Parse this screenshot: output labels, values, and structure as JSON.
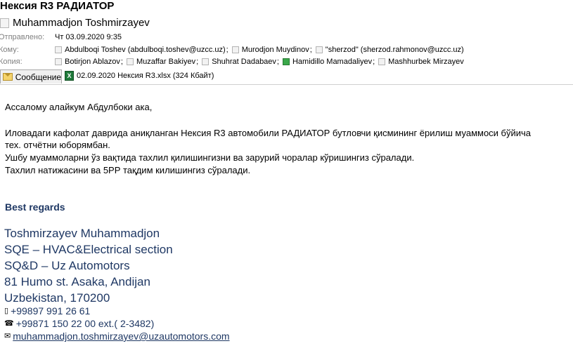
{
  "subject": "Нексия R3 РАДИАТОР",
  "sender": "Muhammadjon Toshmirzayev",
  "meta": {
    "sent_label": "Отправлено:",
    "sent_value": "Чт 03.09.2020 9:35",
    "to_label": "Кому:",
    "to": [
      "Abdulboqi Toshev (abdulboqi.toshev@uzcc.uz)",
      "Murodjon Muydinov",
      "\"sherzod\" (sherzod.rahmonov@uzcc.uz)"
    ],
    "cc_label": "Копия:",
    "cc": [
      "Botirjon Ablazov",
      "Muzaffar Bakiyev",
      "Shuhrat Dadabaev",
      "Hamidillo Mamadaliyev",
      "Mashhurbek Mirzayev"
    ]
  },
  "tabs": {
    "message": "Сообщение",
    "attachment": "02.09.2020 Нексия R3.xlsx (324 Кбайт)"
  },
  "body": {
    "greeting": "Ассалому алайкум Абдулбоки ака,",
    "line1": "Иловадаги кафолат даврида аниқланган Нексия R3 автомобили РАДИАТОР бутловчи қисмининг ёрилиш муаммоси бўйича",
    "line2": "тех. отчётни юборямбан.",
    "line3": "Ушбу муаммоларни ўз вақтида тахлил қилишингизни ва зарурий чоралар кўришингиз сўралади.",
    "line4": "Тахлил натижасини ва 5РР тақдим килишингиз сўралади."
  },
  "signature": {
    "regards": "Best regards",
    "name": "Toshmirzayev Muhammadjon",
    "section": "SQE – HVAC&Electrical  section",
    "company": "SQ&D – Uz Automotors",
    "address": "81 Humo st. Asaka, Andijan",
    "country": "Uzbekistan, 170200",
    "mobile": "+99897 991 26 61",
    "phone": "+99871 150 22 00 ext.( 2-3482)",
    "email": "muhammadjon.toshmirzayev@uzautomotors.com"
  }
}
